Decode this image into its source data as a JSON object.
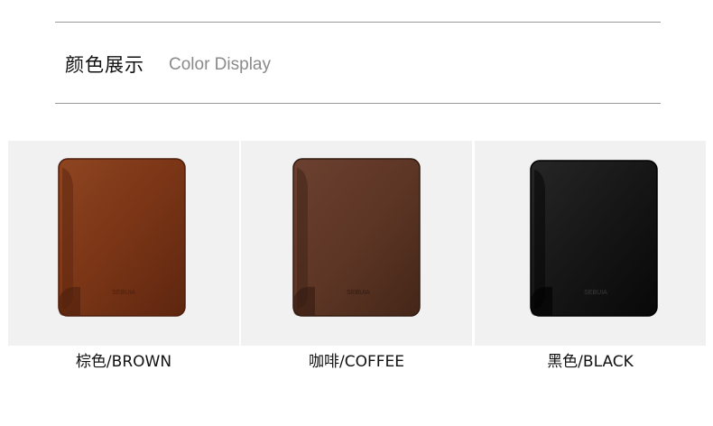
{
  "header": {
    "title_cn": "颜色展示",
    "title_en": "Color Display"
  },
  "products": [
    {
      "label": "棕色/BROWN",
      "color": "#7a3516",
      "dark": "#5a2410",
      "light": "#9b4f2a",
      "image_icon": "wallet-brown"
    },
    {
      "label": "咖啡/COFFEE",
      "color": "#5e3625",
      "dark": "#3f2418",
      "light": "#7a4a35",
      "image_icon": "wallet-coffee"
    },
    {
      "label": "黑色/BLACK",
      "color": "#161616",
      "dark": "#050505",
      "light": "#2a2a2a",
      "image_icon": "wallet-black"
    }
  ]
}
